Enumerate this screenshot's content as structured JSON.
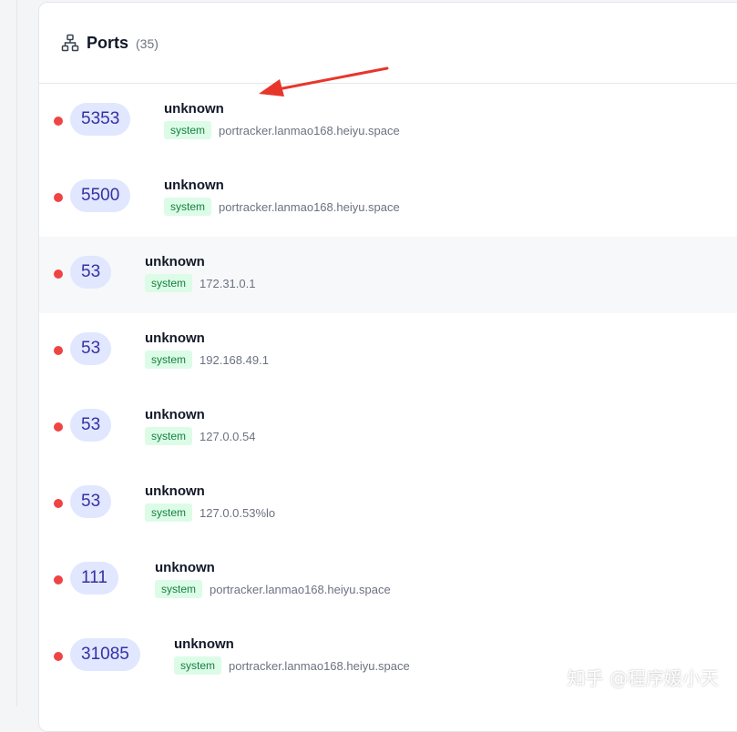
{
  "panel": {
    "title": "Ports",
    "count": "(35)"
  },
  "ports": [
    {
      "port": "5353",
      "service": "unknown",
      "tag": "system",
      "host": "portracker.lanmao168.heiyu.space"
    },
    {
      "port": "5500",
      "service": "unknown",
      "tag": "system",
      "host": "portracker.lanmao168.heiyu.space"
    },
    {
      "port": "53",
      "service": "unknown",
      "tag": "system",
      "host": "172.31.0.1"
    },
    {
      "port": "53",
      "service": "unknown",
      "tag": "system",
      "host": "192.168.49.1"
    },
    {
      "port": "53",
      "service": "unknown",
      "tag": "system",
      "host": "127.0.0.54"
    },
    {
      "port": "53",
      "service": "unknown",
      "tag": "system",
      "host": "127.0.0.53%lo"
    },
    {
      "port": "111",
      "service": "unknown",
      "tag": "system",
      "host": "portracker.lanmao168.heiyu.space"
    },
    {
      "port": "31085",
      "service": "unknown",
      "tag": "system",
      "host": "portracker.lanmao168.heiyu.space"
    }
  ],
  "colors": {
    "status": "#ef4444",
    "pill_bg": "#e0e7ff",
    "pill_text": "#3730a3",
    "tag_bg": "#dcfce7",
    "tag_text": "#15803d",
    "annotation_arrow": "#e8352b"
  },
  "icons": {
    "header": "network-tree-icon",
    "annotation": "red-arrow-annotation"
  },
  "watermark": "知乎 @程序媛小天"
}
